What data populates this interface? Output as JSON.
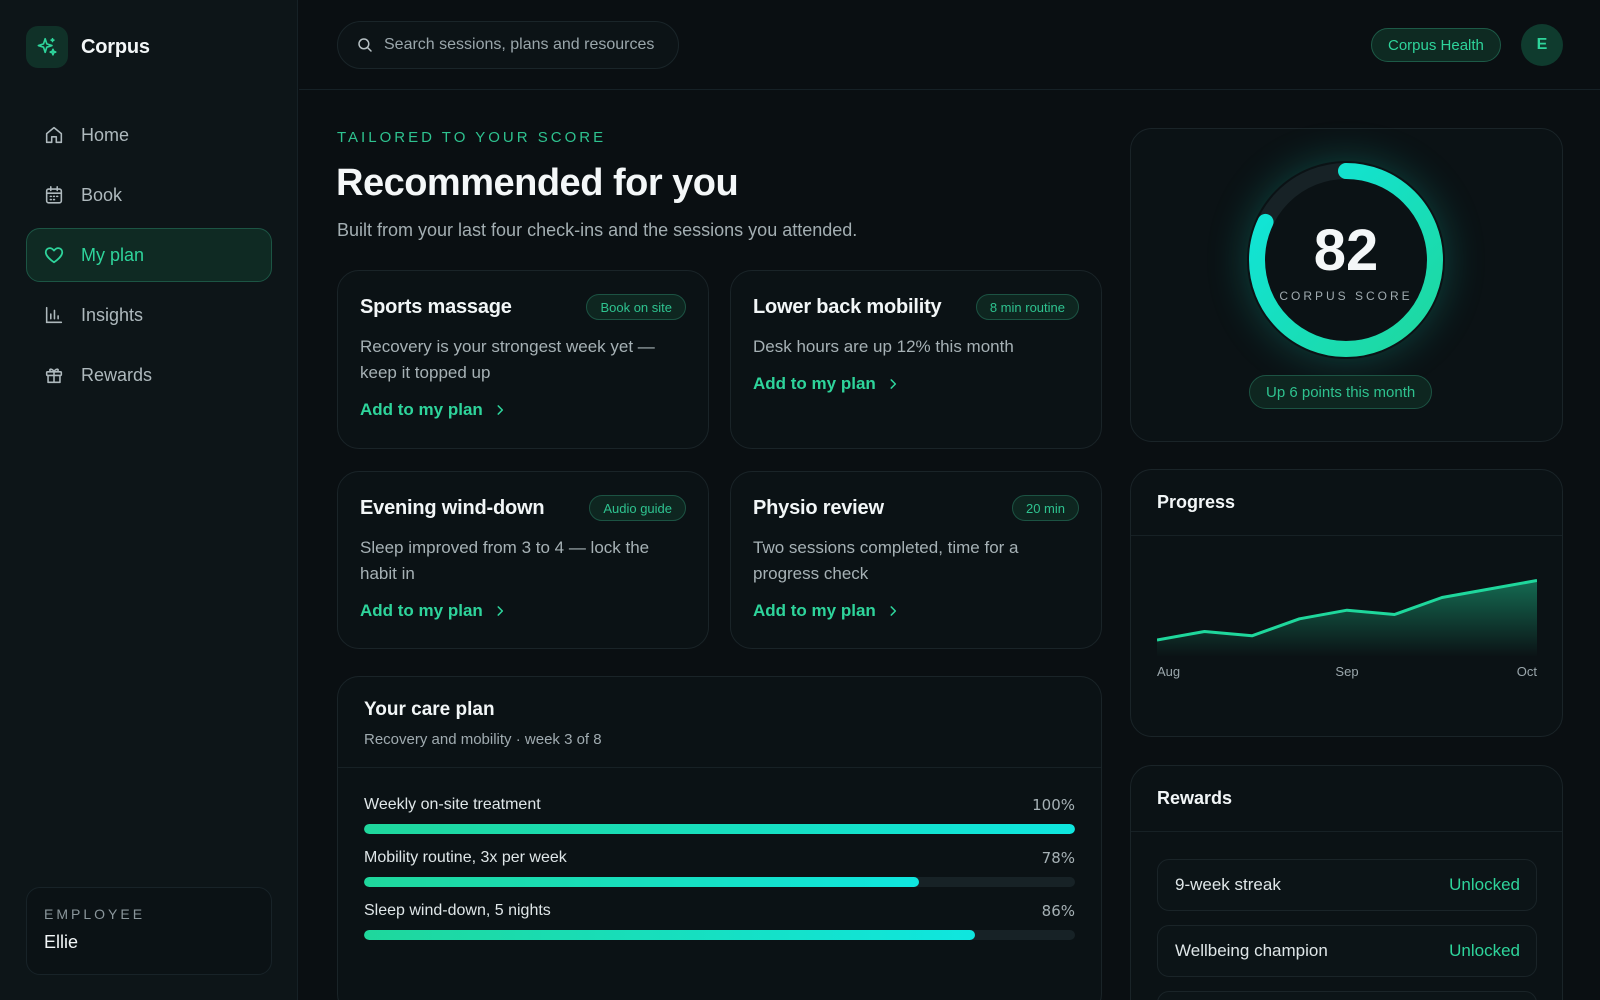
{
  "app": {
    "name": "Corpus"
  },
  "sidebar": {
    "items": [
      {
        "label": "Home",
        "icon": "home-icon"
      },
      {
        "label": "Book",
        "icon": "calendar-icon"
      },
      {
        "label": "My plan",
        "icon": "heart-icon",
        "active": true
      },
      {
        "label": "Insights",
        "icon": "bar-chart-icon"
      },
      {
        "label": "Rewards",
        "icon": "gift-icon"
      }
    ],
    "employee": {
      "label": "EMPLOYEE",
      "name": "Ellie"
    }
  },
  "topbar": {
    "search_placeholder": "Search sessions, plans and resources",
    "org": "Corpus Health",
    "avatar_initial": "E"
  },
  "main": {
    "eyebrow": "TAILORED TO YOUR SCORE",
    "title": "Recommended for you",
    "subtitle": "Built from your last four check-ins and the sessions you attended.",
    "recommendations": [
      {
        "title": "Sports massage",
        "tag": "Book on site",
        "body": "Recovery is your strongest week yet — keep it topped up",
        "link": "Add to my plan"
      },
      {
        "title": "Lower back mobility",
        "tag": "8 min routine",
        "body": "Desk hours are up 12% this month",
        "link": "Add to my plan"
      },
      {
        "title": "Evening wind-down",
        "tag": "Audio guide",
        "body": "Sleep improved from 3 to 4 — lock the habit in",
        "link": "Add to my plan"
      },
      {
        "title": "Physio review",
        "tag": "20 min",
        "body": "Two sessions completed, time for a progress check",
        "link": "Add to my plan"
      }
    ],
    "care_plan": {
      "title": "Your care plan",
      "subtitle": "Recovery and mobility · week 3 of 8",
      "rows": [
        {
          "label": "Weekly on-site treatment",
          "percent_label": "100%",
          "value": 1.0
        },
        {
          "label": "Mobility routine, 3x per week",
          "percent_label": "78%",
          "value": 0.78
        },
        {
          "label": "Sleep wind-down, 5 nights",
          "percent_label": "86%",
          "value": 0.86
        }
      ]
    }
  },
  "score": {
    "value": "82",
    "label": "CORPUS SCORE",
    "ring_fraction": 0.82,
    "delta": "Up 6 points this month"
  },
  "progress": {
    "title": "Progress",
    "x_labels": [
      "Aug",
      "Sep",
      "Oct"
    ],
    "series": [
      62,
      64,
      63,
      67,
      69,
      68,
      72,
      74,
      76
    ]
  },
  "rewards": {
    "title": "Rewards",
    "items": [
      {
        "name": "9-week streak",
        "status": "Unlocked"
      },
      {
        "name": "Wellbeing champion",
        "status": "Unlocked"
      }
    ]
  },
  "colors": {
    "accent": "#2ed49b",
    "accent_cyan": "#0fe6df",
    "background": "#0a0f12"
  }
}
